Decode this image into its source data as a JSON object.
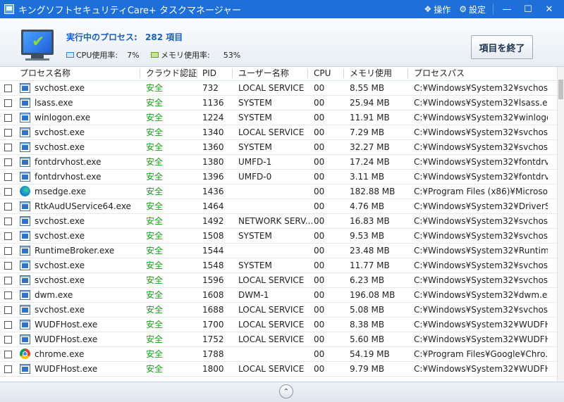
{
  "window": {
    "title": "キングソフトセキュリティCare+ タスクマネージャー",
    "actions": [
      {
        "label": "操作",
        "icon": "operation-icon",
        "glyph": "❖"
      },
      {
        "label": "設定",
        "icon": "gear-icon",
        "glyph": "⚙"
      }
    ],
    "controls": {
      "minimize": "—",
      "maximize": "☐",
      "close": "✕"
    }
  },
  "summary": {
    "processes_label": "実行中のプロセス:",
    "processes_count": "282 項目",
    "cpu_label": "CPU使用率:",
    "cpu_value": "7%",
    "mem_label": "メモリ使用率:",
    "mem_value": "53%",
    "end_button": "項目を終了"
  },
  "table": {
    "columns": [
      "プロセス名称",
      "クラウド認証",
      "PID",
      "ユーザー名称",
      "CPU",
      "メモリ使用",
      "プロセスパス"
    ],
    "rows": [
      {
        "icon": "win",
        "name": "svchost.exe",
        "auth": "安全",
        "pid": "732",
        "user": "LOCAL SERVICE",
        "cpu": "00",
        "mem": "8.55 MB",
        "path": "C:¥Windows¥System32¥svchost..."
      },
      {
        "icon": "win",
        "name": "lsass.exe",
        "auth": "安全",
        "pid": "1136",
        "user": "SYSTEM",
        "cpu": "00",
        "mem": "25.94 MB",
        "path": "C:¥Windows¥System32¥lsass.exe"
      },
      {
        "icon": "win",
        "name": "winlogon.exe",
        "auth": "安全",
        "pid": "1224",
        "user": "SYSTEM",
        "cpu": "00",
        "mem": "11.91 MB",
        "path": "C:¥Windows¥System32¥winlogo..."
      },
      {
        "icon": "win",
        "name": "svchost.exe",
        "auth": "安全",
        "pid": "1340",
        "user": "LOCAL SERVICE",
        "cpu": "00",
        "mem": "7.29 MB",
        "path": "C:¥Windows¥System32¥svchost..."
      },
      {
        "icon": "win",
        "name": "svchost.exe",
        "auth": "安全",
        "pid": "1360",
        "user": "SYSTEM",
        "cpu": "00",
        "mem": "32.27 MB",
        "path": "C:¥Windows¥System32¥svchost..."
      },
      {
        "icon": "win",
        "name": "fontdrvhost.exe",
        "auth": "安全",
        "pid": "1380",
        "user": "UMFD-1",
        "cpu": "00",
        "mem": "17.24 MB",
        "path": "C:¥Windows¥System32¥fontdrv..."
      },
      {
        "icon": "win",
        "name": "fontdrvhost.exe",
        "auth": "安全",
        "pid": "1396",
        "user": "UMFD-0",
        "cpu": "00",
        "mem": "3.11 MB",
        "path": "C:¥Windows¥System32¥fontdrv..."
      },
      {
        "icon": "edge",
        "name": "msedge.exe",
        "auth": "安全",
        "pid": "1436",
        "user": "",
        "cpu": "00",
        "mem": "182.88 MB",
        "path": "C:¥Program Files (x86)¥Microsof..."
      },
      {
        "icon": "win",
        "name": "RtkAudUService64.exe",
        "auth": "安全",
        "pid": "1464",
        "user": "",
        "cpu": "00",
        "mem": "4.76 MB",
        "path": "C:¥Windows¥System32¥DriverSt..."
      },
      {
        "icon": "win",
        "name": "svchost.exe",
        "auth": "安全",
        "pid": "1492",
        "user": "NETWORK SERV...",
        "cpu": "00",
        "mem": "16.83 MB",
        "path": "C:¥Windows¥System32¥svchost..."
      },
      {
        "icon": "win",
        "name": "svchost.exe",
        "auth": "安全",
        "pid": "1508",
        "user": "SYSTEM",
        "cpu": "00",
        "mem": "9.53 MB",
        "path": "C:¥Windows¥System32¥svchost..."
      },
      {
        "icon": "win",
        "name": "RuntimeBroker.exe",
        "auth": "安全",
        "pid": "1544",
        "user": "",
        "cpu": "00",
        "mem": "23.48 MB",
        "path": "C:¥Windows¥System32¥Runtim..."
      },
      {
        "icon": "win",
        "name": "svchost.exe",
        "auth": "安全",
        "pid": "1548",
        "user": "SYSTEM",
        "cpu": "00",
        "mem": "11.77 MB",
        "path": "C:¥Windows¥System32¥svchost..."
      },
      {
        "icon": "win",
        "name": "svchost.exe",
        "auth": "安全",
        "pid": "1596",
        "user": "LOCAL SERVICE",
        "cpu": "00",
        "mem": "6.23 MB",
        "path": "C:¥Windows¥System32¥svchost..."
      },
      {
        "icon": "win",
        "name": "dwm.exe",
        "auth": "安全",
        "pid": "1608",
        "user": "DWM-1",
        "cpu": "00",
        "mem": "196.08 MB",
        "path": "C:¥Windows¥System32¥dwm.exe"
      },
      {
        "icon": "win",
        "name": "svchost.exe",
        "auth": "安全",
        "pid": "1688",
        "user": "LOCAL SERVICE",
        "cpu": "00",
        "mem": "5.08 MB",
        "path": "C:¥Windows¥System32¥svchost..."
      },
      {
        "icon": "win",
        "name": "WUDFHost.exe",
        "auth": "安全",
        "pid": "1700",
        "user": "LOCAL SERVICE",
        "cpu": "00",
        "mem": "8.38 MB",
        "path": "C:¥Windows¥System32¥WUDFH..."
      },
      {
        "icon": "win",
        "name": "WUDFHost.exe",
        "auth": "安全",
        "pid": "1752",
        "user": "LOCAL SERVICE",
        "cpu": "00",
        "mem": "5.60 MB",
        "path": "C:¥Windows¥System32¥WUDFH..."
      },
      {
        "icon": "chrome",
        "name": "chrome.exe",
        "auth": "安全",
        "pid": "1788",
        "user": "",
        "cpu": "00",
        "mem": "54.19 MB",
        "path": "C:¥Program Files¥Google¥Chro..."
      },
      {
        "icon": "win",
        "name": "WUDFHost.exe",
        "auth": "安全",
        "pid": "1800",
        "user": "LOCAL SERVICE",
        "cpu": "00",
        "mem": "9.79 MB",
        "path": "C:¥Windows¥System32¥WUDFH..."
      }
    ]
  },
  "footer": {
    "collapse_glyph": "⌃"
  }
}
